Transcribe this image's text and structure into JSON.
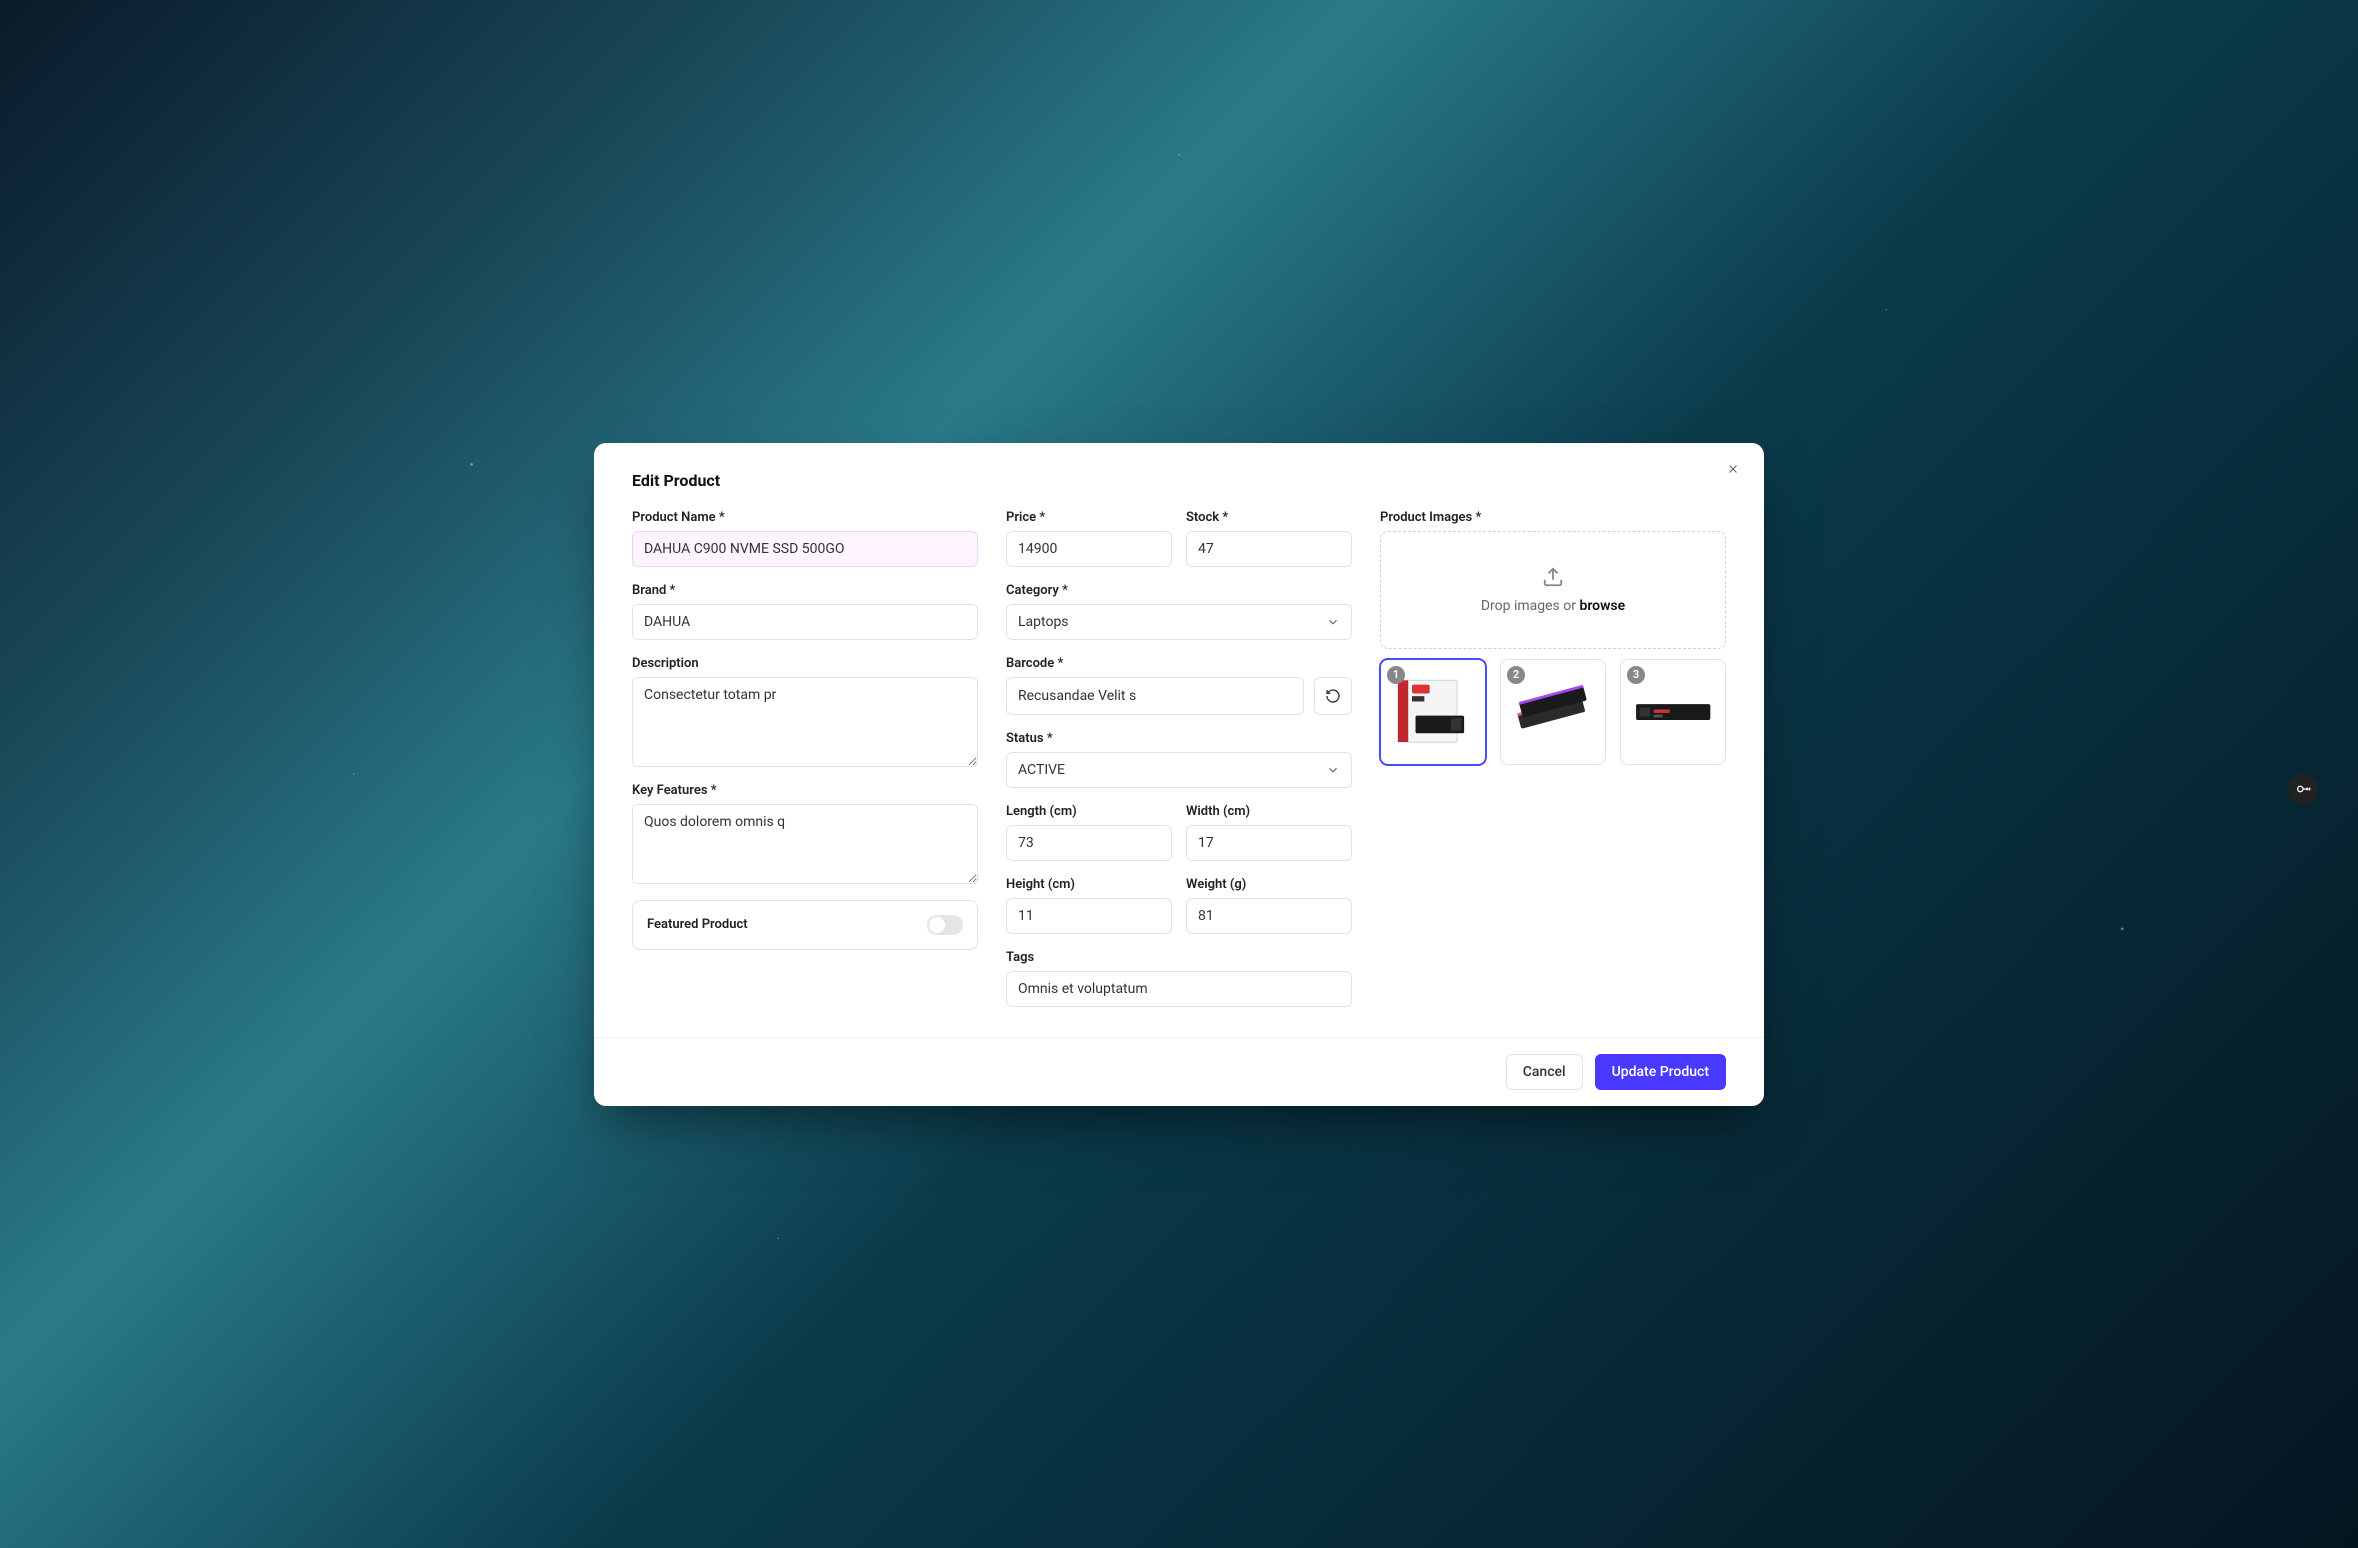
{
  "title": "Edit Product",
  "labels": {
    "productName": "Product Name *",
    "brand": "Brand *",
    "description": "Description",
    "keyFeatures": "Key Features *",
    "featured": "Featured Product",
    "price": "Price *",
    "stock": "Stock *",
    "category": "Category *",
    "barcode": "Barcode *",
    "status": "Status *",
    "length": "Length (cm)",
    "width": "Width (cm)",
    "height": "Height (cm)",
    "weight": "Weight (g)",
    "tags": "Tags",
    "images": "Product Images *"
  },
  "values": {
    "productName": "DAHUA C900 NVME SSD 500GO",
    "brand": "DAHUA",
    "description": "Consectetur totam pr",
    "keyFeatures": "Quos dolorem omnis q",
    "price": "14900",
    "stock": "47",
    "category": "Laptops",
    "barcode": "Recusandae Velit s",
    "status": "ACTIVE",
    "length": "73",
    "width": "17",
    "height": "11",
    "weight": "81",
    "tags": "Omnis et voluptatum",
    "featured": false
  },
  "dropzone": {
    "prefix": "Drop images or ",
    "browse": "browse"
  },
  "thumbs": [
    "1",
    "2",
    "3"
  ],
  "footer": {
    "cancel": "Cancel",
    "update": "Update Product"
  }
}
